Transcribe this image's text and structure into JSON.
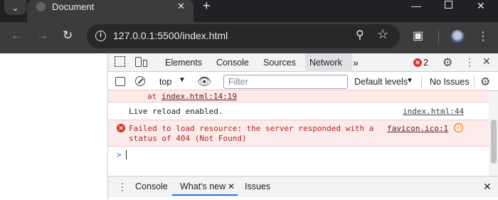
{
  "browser": {
    "tab_title": "Document",
    "url": "127.0.0.1:5500/index.html",
    "icons": [
      "chevron-down-icon",
      "globe-icon",
      "close-icon",
      "plus-icon",
      "minimize-icon",
      "maximize-icon",
      "close-window-icon",
      "back-icon",
      "forward-icon",
      "reload-icon",
      "info-icon",
      "zoom-icon",
      "star-icon",
      "extensions-icon",
      "avatar",
      "kebab-menu-icon"
    ]
  },
  "devtools": {
    "tabs": [
      "Elements",
      "Console",
      "Sources",
      "Network"
    ],
    "active_tab": "Network",
    "error_count": "2",
    "toolbar": {
      "context": "top",
      "filter_placeholder": "Filter",
      "levels": "Default levels",
      "issues": "No Issues"
    },
    "console": {
      "stack_line": {
        "prefix": "at",
        "link": "index.html:14:19"
      },
      "info_line": {
        "text": "Live reload enabled.",
        "link": "index.html:44"
      },
      "error_line": {
        "text1": "Failed to load resource: the server responded with a",
        "text2": "status of 404 (Not Found)",
        "link": "favicon.ico:1"
      },
      "prompt": ">"
    },
    "drawer": {
      "tabs": [
        "Console",
        "What's new",
        "Issues"
      ],
      "active_tab": "What's new"
    }
  },
  "colors": {
    "chrome_dark": "#202124",
    "toolbar": "#3c3c3c",
    "error_red": "#d93025",
    "error_bg": "#fcebeb",
    "accent_blue": "#1a73e8"
  }
}
